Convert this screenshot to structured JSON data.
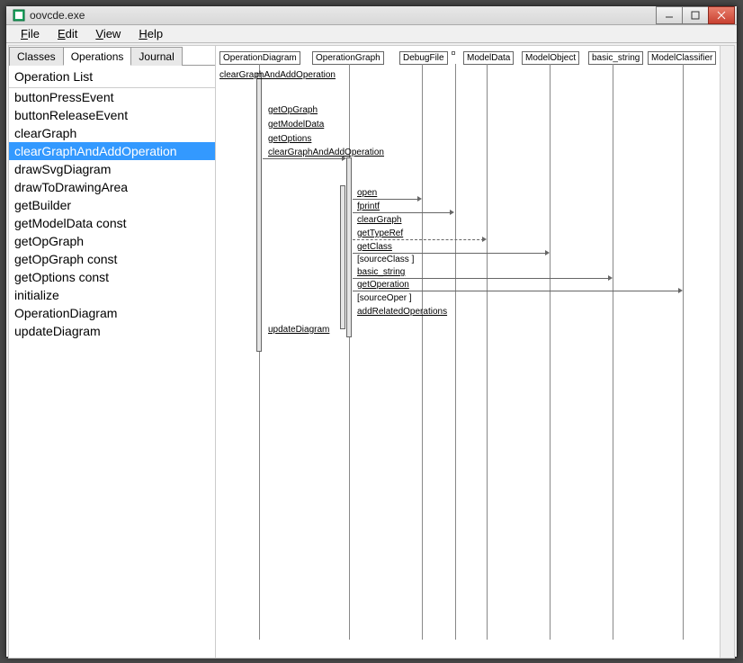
{
  "window": {
    "title": "oovcde.exe"
  },
  "menu": {
    "file": "File",
    "edit": "Edit",
    "view": "View",
    "help": "Help"
  },
  "tabs": {
    "classes": "Classes",
    "operations": "Operations",
    "journal": "Journal",
    "active": "operations"
  },
  "list": {
    "header": "Operation List",
    "items": [
      "buttonPressEvent",
      "buttonReleaseEvent",
      "clearGraph",
      "clearGraphAndAddOperation",
      "drawSvgDiagram",
      "drawToDrawingArea",
      "getBuilder",
      "getModelData const",
      "getOpGraph",
      "getOpGraph const",
      "getOptions const",
      "initialize",
      "OperationDiagram",
      "updateDiagram"
    ],
    "selected": "clearGraphAndAddOperation"
  },
  "diagram": {
    "participants": [
      "OperationDiagram",
      "OperationGraph",
      "DebugFile",
      "ModelData",
      "ModelObject",
      "basic_string",
      "ModelClassifier"
    ],
    "title": "clearGraphAndAddOperation",
    "messages": [
      "getOpGraph",
      "getModelData",
      "getOptions",
      "clearGraphAndAddOperation",
      "open",
      "fprintf",
      "clearGraph",
      "getTypeRef",
      "getClass",
      "[sourceClass ]",
      "basic_string",
      "getOperation",
      "[sourceOper ]",
      "addRelatedOperations",
      "updateDiagram"
    ]
  }
}
